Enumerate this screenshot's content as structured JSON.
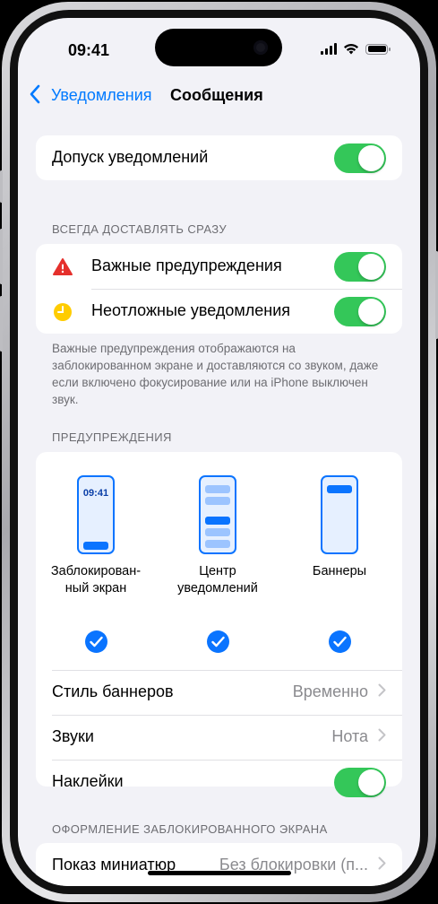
{
  "status": {
    "time": "09:41"
  },
  "nav": {
    "back_label": "Уведомления",
    "title": "Сообщения"
  },
  "allow": {
    "label": "Допуск уведомлений",
    "on": true
  },
  "deliver_section": {
    "header": "ВСЕГДА ДОСТАВЛЯТЬ СРАЗУ",
    "items": [
      {
        "label": "Важные предупреждения",
        "icon": "warning-triangle-icon",
        "on": true
      },
      {
        "label": "Неотложные уведомления",
        "icon": "clock-icon",
        "on": true
      }
    ],
    "footer": "Важные предупреждения отображаются на заблокированном экране и доставляются со звуком, даже если включено фокусирование или на iPhone выключен звук."
  },
  "alerts_section": {
    "header": "ПРЕДУПРЕЖДЕНИЯ",
    "styles": [
      {
        "label_line1": "Заблокирован-",
        "label_line2": "ный экран",
        "mini_time": "09:41",
        "checked": true
      },
      {
        "label_line1": "Центр",
        "label_line2": "уведомлений",
        "checked": true
      },
      {
        "label_line1": "Баннеры",
        "label_line2": "",
        "checked": true
      }
    ],
    "banner_style": {
      "label": "Стиль баннеров",
      "value": "Временно"
    },
    "sounds": {
      "label": "Звуки",
      "value": "Нота"
    },
    "badges": {
      "label": "Наклейки",
      "on": true
    }
  },
  "lock_section": {
    "header": "ОФОРМЛЕНИЕ ЗАБЛОКИРОВАННОГО ЭКРАНА",
    "previews": {
      "label": "Показ миниатюр",
      "value": "Без блокировки (п..."
    }
  },
  "colors": {
    "accent": "#007aff",
    "toggle_on": "#34c759",
    "warning": "#e5302c",
    "clock": "#ffcc00"
  }
}
